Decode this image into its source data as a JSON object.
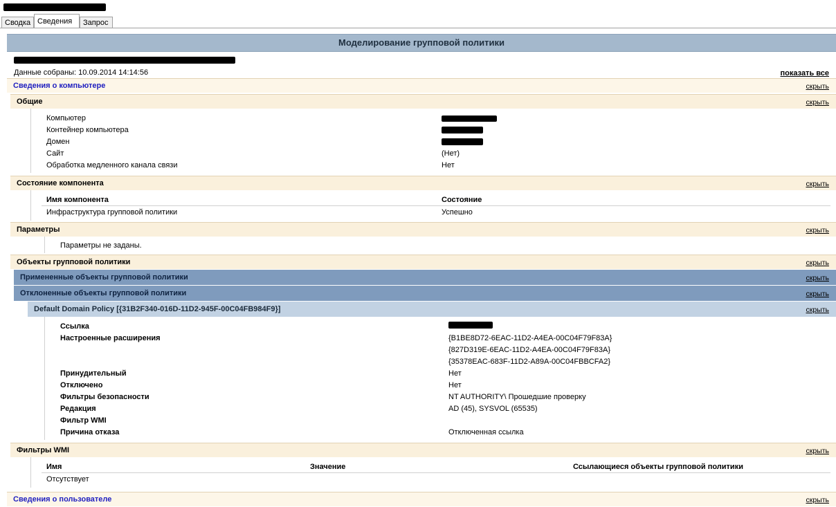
{
  "tabs": [
    {
      "label": "Сводка",
      "active": false
    },
    {
      "label": "Сведения",
      "active": true
    },
    {
      "label": "Запрос",
      "active": false
    }
  ],
  "report_title": "Моделирование групповой политики",
  "data_collected": "Данные собраны: 10.09.2014 14:14:56",
  "show_all": "показать все",
  "hide_label": "скрыть",
  "computer_section": {
    "title": "Сведения о компьютере",
    "general": {
      "title": "Общие",
      "rows": [
        {
          "label": "Компьютер",
          "value": ""
        },
        {
          "label": "Контейнер компьютера",
          "value": ""
        },
        {
          "label": "Домен",
          "value": ""
        },
        {
          "label": "Сайт",
          "value": "(Нет)"
        },
        {
          "label": "Обработка медленного канала связи",
          "value": "Нет"
        }
      ]
    },
    "component_status": {
      "title": "Состояние компонента",
      "headers": [
        "Имя компонента",
        "Состояние"
      ],
      "rows": [
        {
          "name": "Инфраструктура групповой политики",
          "status": "Успешно"
        }
      ]
    },
    "parameters": {
      "title": "Параметры",
      "text": "Параметры не заданы."
    },
    "gpo": {
      "title": "Объекты групповой политики",
      "applied_title": "Примененные объекты групповой политики",
      "denied_title": "Отклоненные объекты групповой политики",
      "policy": {
        "title": "Default Domain Policy [{31B2F340-016D-11D2-945F-00C04FB984F9}]",
        "labels": {
          "link": "Ссылка",
          "extensions": "Настроенные расширения",
          "enforced": "Принудительный",
          "disabled": "Отключено",
          "security_filters": "Фильтры безопасности",
          "revision": "Редакция",
          "wmi_filter": "Фильтр WMI",
          "reason": "Причина отказа"
        },
        "values": {
          "extensions": [
            "{B1BE8D72-6EAC-11D2-A4EA-00C04F79F83A}",
            "{827D319E-6EAC-11D2-A4EA-00C04F79F83A}",
            "{35378EAC-683F-11D2-A89A-00C04FBBCFA2}"
          ],
          "enforced": "Нет",
          "disabled": "Нет",
          "security_filters": "NT AUTHORITY\\ Прошедшие проверку",
          "revision": "AD (45), SYSVOL (65535)",
          "wmi_filter": "",
          "reason": "Отключенная ссылка"
        }
      }
    },
    "wmi": {
      "title": "Фильтры WMI",
      "headers": [
        "Имя",
        "Значение",
        "Ссылающиеся объекты групповой политики"
      ],
      "empty_text": "Отсутствует"
    }
  },
  "user_section": {
    "title": "Сведения о пользователе"
  },
  "colors": {
    "title_bar": "#a4b8cc",
    "section_bar": "#faf0dc",
    "applied_bar": "#7f9bbd",
    "policy_bar": "#c2d2e3",
    "section_link": "#2020c0"
  }
}
